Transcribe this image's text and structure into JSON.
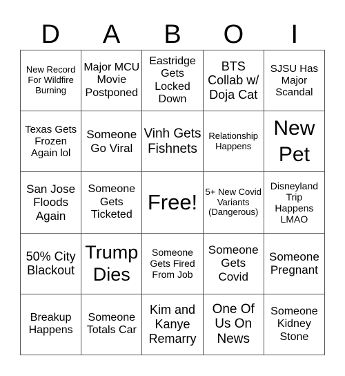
{
  "header": [
    "D",
    "A",
    "B",
    "O",
    "I"
  ],
  "cells": [
    "New Record For Wildfire Burning",
    "Major MCU Movie Postponed",
    "Eastridge Gets Locked Down",
    "BTS Collab w/ Doja Cat",
    "SJSU Has Major Scandal",
    "Texas Gets Frozen Again lol",
    "Someone Go Viral",
    "Vinh Gets Fishnets",
    "Relationship Happens",
    "New Pet",
    "San Jose Floods Again",
    "Someone Gets Ticketed",
    "Free!",
    "5+ New Covid Variants (Dangerous)",
    "Disneyland Trip Happens LMAO",
    "50% City Blackout",
    "Trump Dies",
    "Someone Gets Fired From Job",
    "Someone Gets Covid",
    "Someone Pregnant",
    "Breakup Happens",
    "Someone Totals Car",
    "Kim and Kanye Remarry",
    "One Of Us On News",
    "Someone Kidney Stone"
  ]
}
